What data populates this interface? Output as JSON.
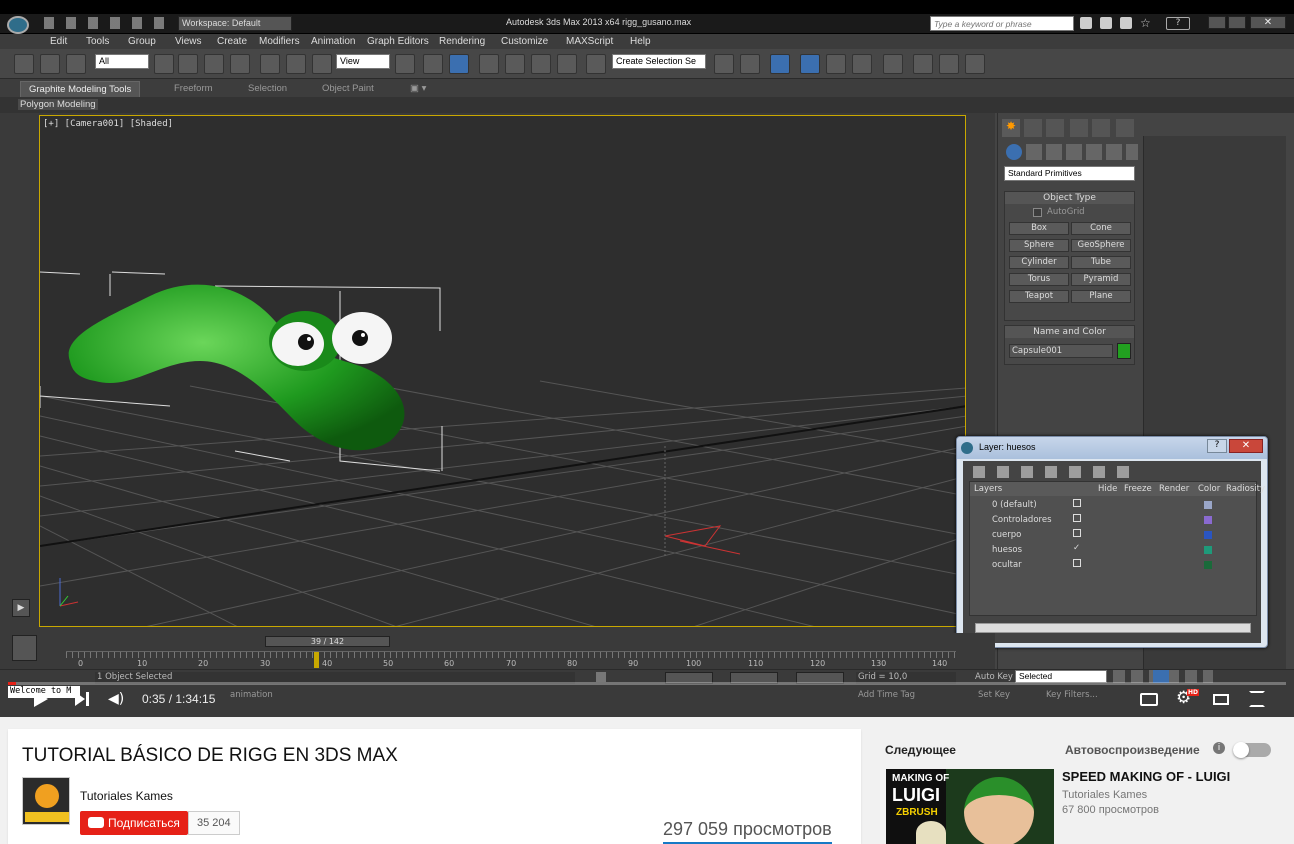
{
  "app": {
    "title": "Autodesk 3ds Max  2013 x64      rigg_gusano.max",
    "workspace": "Workspace: Default",
    "search_placeholder": "Type a keyword or phrase"
  },
  "menu": [
    "Edit",
    "Tools",
    "Group",
    "Views",
    "Create",
    "Modifiers",
    "Animation",
    "Graph Editors",
    "Rendering",
    "Customize",
    "MAXScript",
    "Help"
  ],
  "toolbar": {
    "filter_value": "All",
    "view_value": "View",
    "selection_set": "Create Selection Se"
  },
  "ribbon": {
    "tabs": [
      "Graphite Modeling Tools",
      "Freeform",
      "Selection",
      "Object Paint"
    ],
    "sub": "Polygon Modeling"
  },
  "viewport": {
    "label": "[+] [Camera001] [Shaded]"
  },
  "command_panel": {
    "category": "Standard Primitives",
    "object_type_title": "Object Type",
    "autogrid": "AutoGrid",
    "buttons": [
      "Box",
      "Cone",
      "Sphere",
      "GeoSphere",
      "Cylinder",
      "Tube",
      "Torus",
      "Pyramid",
      "Teapot",
      "Plane"
    ],
    "name_color_title": "Name and Color",
    "object_name": "Capsule001",
    "object_color": "#22a020"
  },
  "layer_window": {
    "title": "Layer: huesos",
    "columns": [
      "Layers",
      "Hide",
      "Freeze",
      "Render",
      "Color",
      "Radiosity"
    ],
    "rows": [
      {
        "name": "0 (default)",
        "color": "#9aa6c8"
      },
      {
        "name": "Controladores",
        "color": "#8a6ad0"
      },
      {
        "name": "cuerpo",
        "color": "#2a55c0"
      },
      {
        "name": "huesos",
        "color": "#1f9a7a"
      },
      {
        "name": "ocultar",
        "color": "#1a6a3a"
      }
    ]
  },
  "timeline": {
    "frame_display": "39 / 142",
    "ticks": [
      "0",
      "10",
      "20",
      "30",
      "40",
      "50",
      "60",
      "70",
      "80",
      "90",
      "100",
      "110",
      "120",
      "130",
      "140"
    ]
  },
  "status": {
    "selected": "1 Object Selected",
    "hint": "animation",
    "grid": "Grid = 10,0",
    "auto_key": "Auto Key",
    "key_mode": "Selected",
    "set_key": "Set Key",
    "key_filters": "Key Filters...",
    "add_time_tag": "Add Time Tag",
    "welcome": "Welcome to M"
  },
  "player": {
    "time": "0:35 / 1:34:15",
    "progress": 0.0062
  },
  "video": {
    "title": "TUTORIAL BÁSICO DE RIGG EN 3DS MAX",
    "channel": "Tutoriales Kames",
    "subscribe": "Подписаться",
    "subscribers": "35 204",
    "views": "297 059 просмотров"
  },
  "sidebar": {
    "next_label": "Следующее",
    "autoplay_label": "Автовоспроизведение",
    "next_title": "SPEED MAKING OF - LUIGI",
    "next_channel": "Tutoriales Kames",
    "next_views": "67 800 просмотров",
    "thumb_text_1": "MAKING OF",
    "thumb_text_2": "LUIGI",
    "thumb_text_3": "ZBRUSH"
  },
  "colors": {
    "yt_red": "#e62117",
    "accent_blue": "#3b6fb0"
  }
}
